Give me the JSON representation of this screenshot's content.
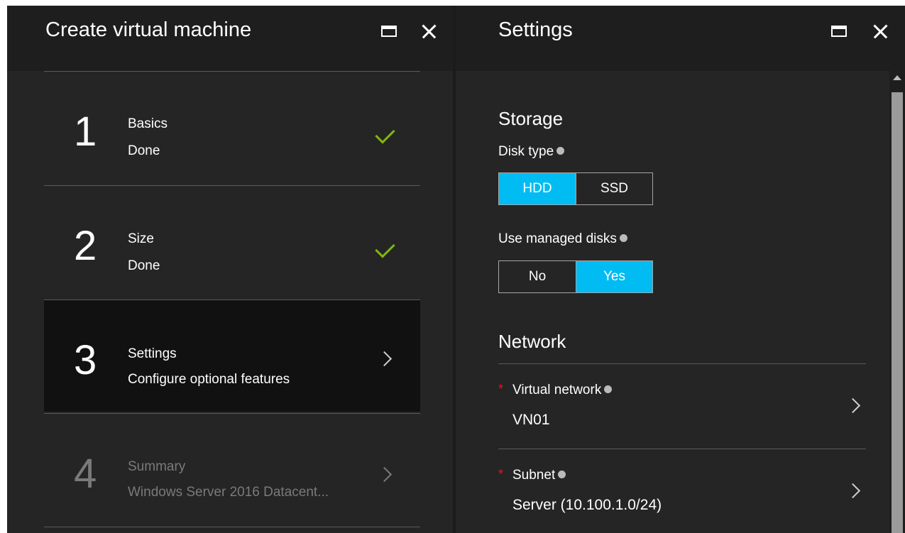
{
  "left_blade": {
    "title": "Create virtual machine",
    "steps": [
      {
        "number": "1",
        "title": "Basics",
        "status": "Done",
        "state": "complete",
        "icon": "checkmark-icon"
      },
      {
        "number": "2",
        "title": "Size",
        "status": "Done",
        "state": "complete",
        "icon": "checkmark-icon"
      },
      {
        "number": "3",
        "title": "Settings",
        "status": "Configure optional features",
        "state": "active",
        "icon": "chevron-right-icon"
      },
      {
        "number": "4",
        "title": "Summary",
        "status": "Windows Server 2016 Datacent...",
        "state": "disabled",
        "icon": "chevron-right-icon"
      }
    ]
  },
  "right_blade": {
    "title": "Settings",
    "storage": {
      "heading": "Storage",
      "disk_type": {
        "label": "Disk type",
        "options": [
          "HDD",
          "SSD"
        ],
        "selected": "HDD"
      },
      "managed_disks": {
        "label": "Use managed disks",
        "options": [
          "No",
          "Yes"
        ],
        "selected": "Yes"
      }
    },
    "network": {
      "heading": "Network",
      "virtual_network": {
        "required_marker": "*",
        "label": "Virtual network",
        "value": "VN01"
      },
      "subnet": {
        "required_marker": "*",
        "label": "Subnet",
        "value": "Server (10.100.1.0/24)"
      }
    }
  },
  "colors": {
    "accent": "#00bcf2",
    "check": "#7fba00",
    "required": "#e81123",
    "background": "#252525",
    "active_step": "#111111"
  }
}
